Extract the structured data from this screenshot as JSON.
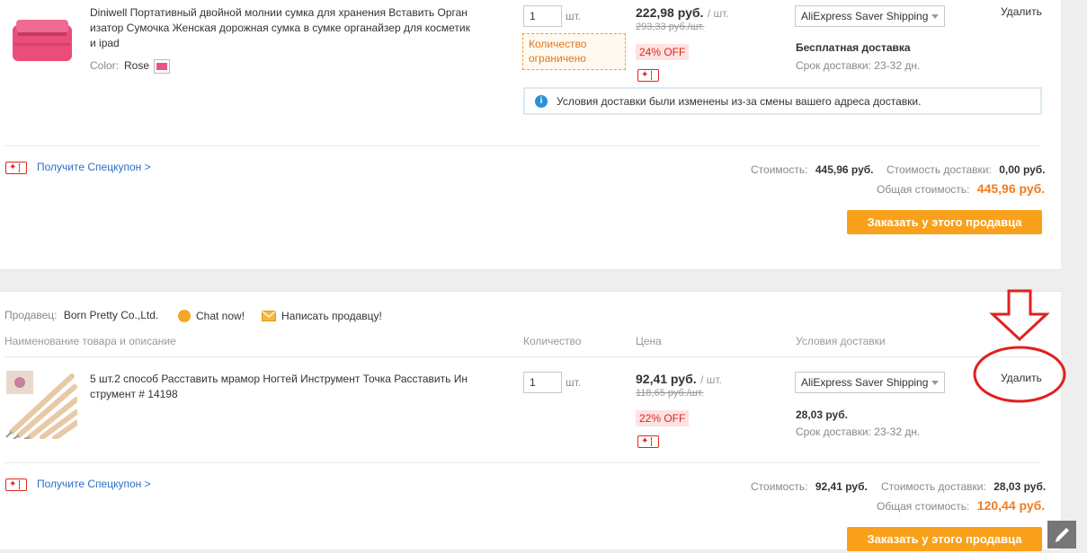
{
  "item1": {
    "title": "Diniwell Портативный двойной молнии сумка для хранения Вставить Орган изатор Сумочка Женская дорожная сумка в сумке органайзер для косметик и ipad",
    "color_label": "Color:",
    "color_value": "Rose",
    "qty": "1",
    "unit": "шт.",
    "limited": "Количество ограничено",
    "price": "222,98 руб.",
    "price_unit": "/ шт.",
    "old_price": "293,33 руб./шт.",
    "off": "24% OFF",
    "shipping": "AliExpress Saver Shipping",
    "delete": "Удалить",
    "ship_cost": "Бесплатная доставка",
    "delivery_time": "Срок доставки: 23-32 дн.",
    "notice": "Условия доставки были изменены из-за смены вашего адреса доставки.",
    "coupon_link": "Получите Спецкупон >",
    "cost_label": "Стоимость:",
    "cost_val": "445,96 руб.",
    "ship_label": "Стоимость доставки:",
    "ship_val": "0,00 руб.",
    "total_label": "Общая стоимость:",
    "total_val": "445,96 руб.",
    "order_btn": "Заказать у этого продавца"
  },
  "seller2": {
    "seller_label": "Продавец:",
    "seller_name": "Born Pretty Co.,Ltd.",
    "chat": "Chat now!",
    "message": "Написать продавцу!"
  },
  "headers": {
    "name": "Наименование товара и описание",
    "qty": "Количество",
    "price": "Цена",
    "shipping": "Условия доставки"
  },
  "item2": {
    "title": "5 шт.2 способ Расставить мрамор Ногтей Инструмент Точка Расставить Ин струмент # 14198",
    "qty": "1",
    "unit": "шт.",
    "price": "92,41 руб.",
    "price_unit": "/ шт.",
    "old_price": "118,65 руб./шт.",
    "off": "22% OFF",
    "shipping": "AliExpress Saver Shipping",
    "delete": "Удалить",
    "ship_cost": "28,03 руб.",
    "delivery_time": "Срок доставки: 23-32 дн.",
    "coupon_link": "Получите Спецкупон >",
    "cost_label": "Стоимость:",
    "cost_val": "92,41 руб.",
    "ship_label": "Стоимость доставки:",
    "ship_val": "28,03 руб.",
    "total_label": "Общая стоимость:",
    "total_val": "120,44 руб.",
    "order_btn": "Заказать у этого продавца"
  },
  "colors": {
    "accent": "#f9a11b",
    "total": "#f37b1d",
    "sale": "#e1251b",
    "link": "#2a6ec6",
    "annotation": "#e02020"
  }
}
